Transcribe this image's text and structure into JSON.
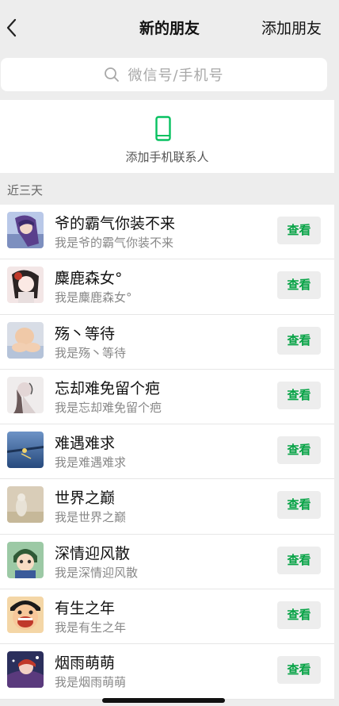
{
  "nav": {
    "title": "新的朋友",
    "action": "添加朋友",
    "back_icon": "chevron-left-icon"
  },
  "search": {
    "placeholder": "微信号/手机号",
    "icon": "search-icon"
  },
  "add_contacts": {
    "label": "添加手机联系人",
    "icon": "phone-icon",
    "icon_color": "#07c160"
  },
  "section": {
    "label": "近三天"
  },
  "requests": [
    {
      "name": "爷的霸气你装不来",
      "message": "我是爷的霸气你装不来",
      "action": "查看",
      "avatar": "anime-girl-avatar-icon"
    },
    {
      "name": "麋鹿森女°",
      "message": "我是麋鹿森女°",
      "action": "查看",
      "avatar": "chibi-girl-avatar-icon"
    },
    {
      "name": "殇丶等待",
      "message": "我是殇丶等待",
      "action": "查看",
      "avatar": "baby-avatar-icon"
    },
    {
      "name": "忘却难免留个疤",
      "message": "我是忘却难免留个疤",
      "action": "查看",
      "avatar": "sketch-girl-avatar-icon"
    },
    {
      "name": "难遇难求",
      "message": "我是难遇难求",
      "action": "查看",
      "avatar": "ocean-avatar-icon"
    },
    {
      "name": "世界之巅",
      "message": "我是世界之巅",
      "action": "查看",
      "avatar": "beige-photo-avatar-icon"
    },
    {
      "name": "深情迎风散",
      "message": "我是深情迎风散",
      "action": "查看",
      "avatar": "cartoon-kid-avatar-icon"
    },
    {
      "name": "有生之年",
      "message": "我是有生之年",
      "action": "查看",
      "avatar": "laughing-face-avatar-icon"
    },
    {
      "name": "烟雨萌萌",
      "message": "我是烟雨萌萌",
      "action": "查看",
      "avatar": "fantasy-character-avatar-icon"
    }
  ],
  "colors": {
    "accent": "#07a346",
    "background": "#ededed"
  }
}
